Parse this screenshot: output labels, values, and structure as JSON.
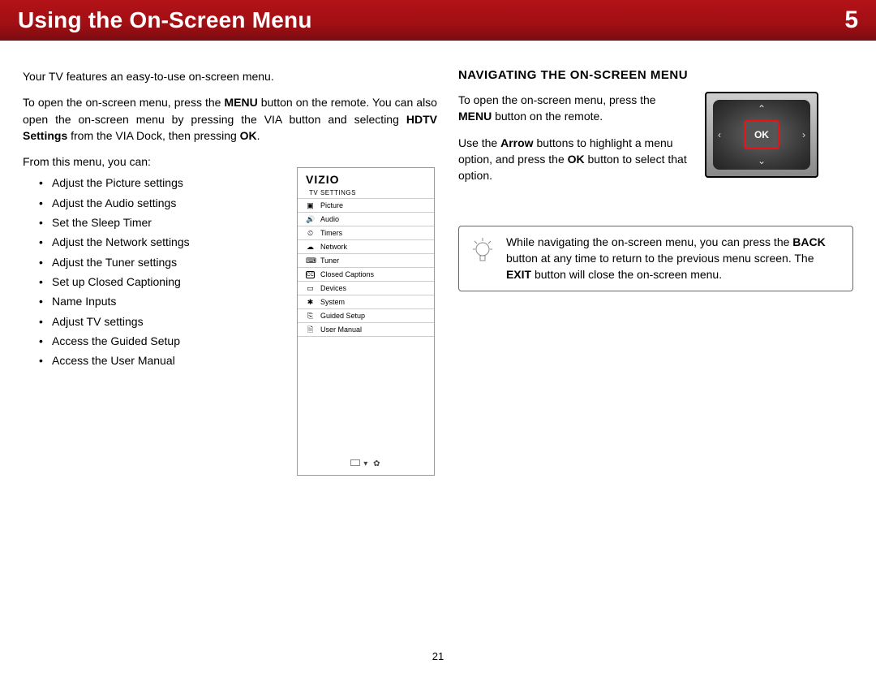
{
  "header": {
    "title": "Using the On-Screen Menu",
    "chapter": "5"
  },
  "left": {
    "p1": "Your TV features an easy-to-use on-screen menu.",
    "p2_a": "To open the on-screen menu, press the ",
    "p2_b_bold": "MENU",
    "p2_c": " button on the remote. You can also open the on-screen menu by pressing the VIA button and selecting ",
    "p2_d_bold": "HDTV Settings",
    "p2_e": " from the VIA Dock, then pressing ",
    "p2_f_bold": "OK",
    "p2_g": ".",
    "p3": "From this menu, you can:",
    "bullets": [
      "Adjust the Picture settings",
      "Adjust the Audio settings",
      "Set the Sleep Timer",
      "Adjust the Network settings",
      "Adjust the Tuner settings",
      "Set up Closed Captioning",
      "Name Inputs",
      "Adjust TV settings",
      "Access the Guided Setup",
      "Access the User Manual"
    ]
  },
  "tv_panel": {
    "brand": "VIZIO",
    "subtitle": "TV SETTINGS",
    "items": [
      {
        "icon": "▣",
        "label": "Picture"
      },
      {
        "icon": "🔊",
        "label": "Audio"
      },
      {
        "icon": "⏲",
        "label": "Timers"
      },
      {
        "icon": "☁",
        "label": "Network"
      },
      {
        "icon": "⌨",
        "label": "Tuner"
      },
      {
        "icon": "CC",
        "label": "Closed Captions"
      },
      {
        "icon": "▭",
        "label": "Devices"
      },
      {
        "icon": "✱",
        "label": "System"
      },
      {
        "icon": "⎘",
        "label": "Guided Setup"
      },
      {
        "icon": "🗎",
        "label": "User Manual"
      }
    ]
  },
  "right": {
    "h2": "NAVIGATING THE ON-SCREEN MENU",
    "p1_a": "To open the on-screen menu, press the ",
    "p1_b_bold": "MENU",
    "p1_c": " button on the remote.",
    "p2_a": "Use the ",
    "p2_b_bold": "Arrow",
    "p2_c": " buttons to highlight a menu option, and press the ",
    "p2_d_bold": "OK",
    "p2_e": " button to select that option.",
    "ok_label": "OK",
    "tip_a": "While navigating the on-screen menu, you can press the ",
    "tip_b_bold": "BACK",
    "tip_c": " button at any time to return to the previous menu screen. The ",
    "tip_d_bold": "EXIT",
    "tip_e": " button will close the on-screen menu."
  },
  "page_number": "21"
}
